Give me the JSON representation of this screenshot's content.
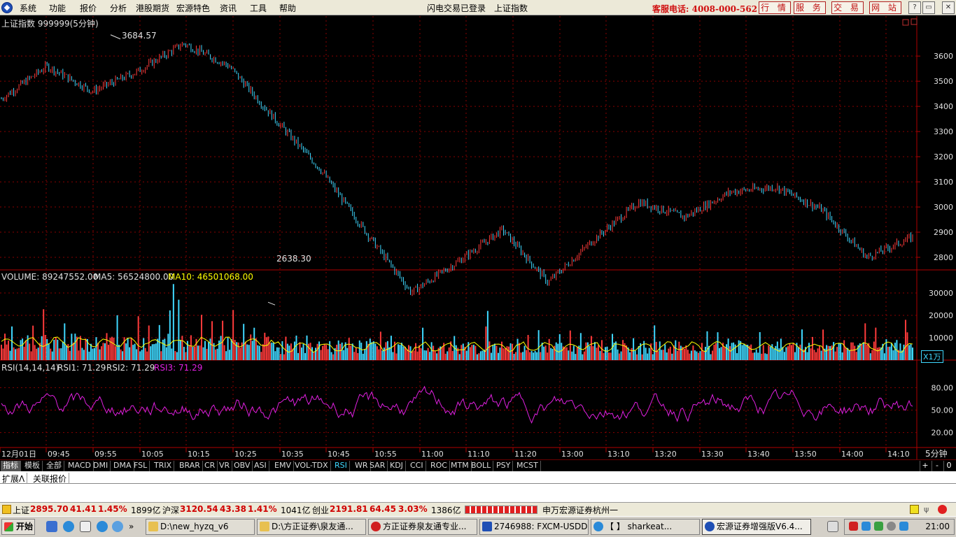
{
  "menubar": {
    "items": [
      "系统",
      "功能",
      "报价",
      "分析",
      "港股期货",
      "宏源特色",
      "资讯",
      "工具",
      "帮助"
    ],
    "login_status": "闪电交易已登录",
    "current_symbol": "上证指数",
    "hotline": "客服电话: 4008-000-562",
    "buttons": [
      "行 情",
      "服 务",
      "交 易",
      "网 站"
    ],
    "window_controls": [
      "?",
      "▭",
      "▭",
      "✕"
    ]
  },
  "chart": {
    "title": "上证指数 999999(5分钟)",
    "high_label": "3684.57",
    "low_label": "2638.30",
    "price_ticks": [
      "3600",
      "3500",
      "3400",
      "3300",
      "3200",
      "3100",
      "3000",
      "2900",
      "2800"
    ],
    "volume_title_label": "VOLUME: 89247552.00",
    "ma5_label": "MA5: 56524800.00",
    "ma10_label": "MA10: 46501068.00",
    "volume_ticks": [
      "30000",
      "20000",
      "10000"
    ],
    "volume_unit": "X1万",
    "rsi_title": "RSI(14,14,14)",
    "rsi1_label": "RSI1: 71.29",
    "rsi2_label": "RSI2: 71.29",
    "rsi3_label": "RSI3: 71.29",
    "rsi_ticks": [
      "80.00",
      "50.00",
      "20.00"
    ],
    "time_ticks": [
      "12月01日",
      "09:45",
      "09:55",
      "10:05",
      "10:15",
      "10:25",
      "10:35",
      "10:45",
      "10:55",
      "11:00",
      "11:10",
      "11:20",
      "13:00",
      "13:10",
      "13:20",
      "13:30",
      "13:40",
      "13:50",
      "14:00",
      "14:10"
    ],
    "period_label": "5分钟",
    "colors": {
      "up": "#ff3b3b",
      "down": "#3fd8ff",
      "ma10": "#ffff00",
      "rsi": "#e020e0",
      "grid": "#8b0000"
    }
  },
  "chart_data": {
    "type": "candlestick",
    "title": "上证指数 999999(5分钟)",
    "series": [
      {
        "name": "上证指数",
        "x": [
          0,
          5,
          10,
          15,
          20,
          25,
          30,
          35,
          40,
          45,
          50,
          55,
          60,
          65,
          70,
          75,
          80,
          85,
          90,
          95,
          100
        ],
        "values": [
          3430,
          3560,
          3460,
          3540,
          3650,
          3560,
          3350,
          3150,
          2900,
          2660,
          2780,
          2910,
          2700,
          2870,
          3020,
          2960,
          3060,
          3080,
          2990,
          2800,
          2880
        ]
      }
    ],
    "high": 3684.57,
    "low": 2638.3,
    "ylim": [
      2750,
      3720
    ],
    "volume": {
      "name": "VOLUME",
      "last": 89247552.0,
      "ma5": 56524800.0,
      "ma10": 46501068.0,
      "unit": "X1万",
      "ylim": [
        0,
        35000
      ]
    },
    "rsi": {
      "params": "14,14,14",
      "rsi1": 71.29,
      "rsi2": 71.29,
      "rsi3": 71.29,
      "ylim": [
        0,
        100
      ]
    },
    "grid": true
  },
  "indicator_tabs": [
    "指标",
    "模板",
    "全部",
    "MACD",
    "DMI",
    "DMA",
    "FSL",
    "TRIX",
    "BRAR",
    "CR",
    "VR",
    "OBV",
    "ASI",
    "EMV",
    "VOL-TDX",
    "RSI",
    "WR",
    "SAR",
    "KDJ",
    "CCI",
    "ROC",
    "MTM",
    "BOLL",
    "PSY",
    "MCST"
  ],
  "active_indicator": "RSI",
  "tab_controls": [
    "+",
    "-",
    "0"
  ],
  "subtabs": [
    "扩展Λ",
    "关联报价"
  ],
  "statusbar": {
    "sh_label": "上证",
    "sh_value": "2895.70",
    "sh_change": "41.41",
    "sh_pct": "1.45%",
    "sh_amount": "1899亿",
    "hs_label": "沪深",
    "hs_value": "3120.54",
    "hs_change": "43.38",
    "hs_pct": "1.41%",
    "hs_amount": "1041亿",
    "cy_label": "创业",
    "cy_value": "2191.81",
    "cy_change": "64.45",
    "cy_pct": "3.03%",
    "cy_amount": "1386亿",
    "broker": "申万宏源证券杭州一"
  },
  "taskbar": {
    "start": "开始",
    "tasks": [
      "D:\\new_hyzq_v6",
      "D:\\方正证券\\泉友通...",
      "方正证券泉友通专业...",
      "2746988: FXCM-USDD...",
      "【        】 sharkeat...",
      "宏源证券增强版V6.4..."
    ],
    "clock": "21:00"
  }
}
